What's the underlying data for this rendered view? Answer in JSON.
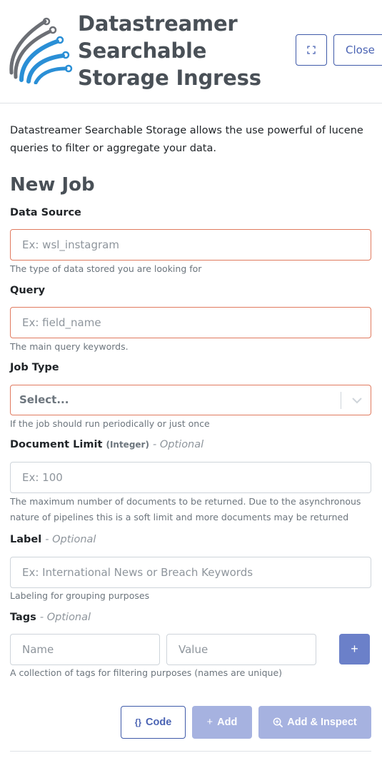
{
  "header": {
    "title": "Datastreamer Searchable Storage Ingress",
    "close_label": "Close",
    "expand_icon": "expand-icon",
    "logo_icon": "datastreamer-logo"
  },
  "intro": {
    "description": "Datastreamer Searchable Storage allows the use powerful of lucene queries to filter or aggregate your data."
  },
  "form": {
    "heading": "New Job",
    "data_source": {
      "label": "Data Source",
      "placeholder": "Ex: wsl_instagram",
      "value": "",
      "help": "The type of data stored you are looking for"
    },
    "query": {
      "label": "Query",
      "placeholder": "Ex: field_name",
      "value": "",
      "help": "The main query keywords."
    },
    "job_type": {
      "label": "Job Type",
      "selected": "Select...",
      "help": "If the job should run periodically or just once"
    },
    "document_limit": {
      "label": "Document Limit",
      "type_hint": "(Integer)",
      "optional": "- Optional",
      "placeholder": "Ex: 100",
      "value": "",
      "help": "The maximum number of documents to be returned. Due to the asynchronous nature of pipelines this is a soft limit and more documents may be returned"
    },
    "label_field": {
      "label": "Label",
      "optional": "- Optional",
      "placeholder": "Ex: International News or Breach Keywords",
      "value": "",
      "help": "Labeling for grouping purposes"
    },
    "tags": {
      "label": "Tags",
      "optional": "- Optional",
      "name_placeholder": "Name",
      "value_placeholder": "Value",
      "add_symbol": "+",
      "help": "A collection of tags for filtering purposes (names are unique)"
    }
  },
  "actions": {
    "code_icon": "{}",
    "code_label": "Code",
    "add_icon": "+",
    "add_label": "Add",
    "inspect_label": "Add & Inspect"
  },
  "colors": {
    "primary": "#3f5aa9",
    "primary_light": "#a6b2e0",
    "invalid_border": "#e07a5f",
    "title": "#495057"
  }
}
